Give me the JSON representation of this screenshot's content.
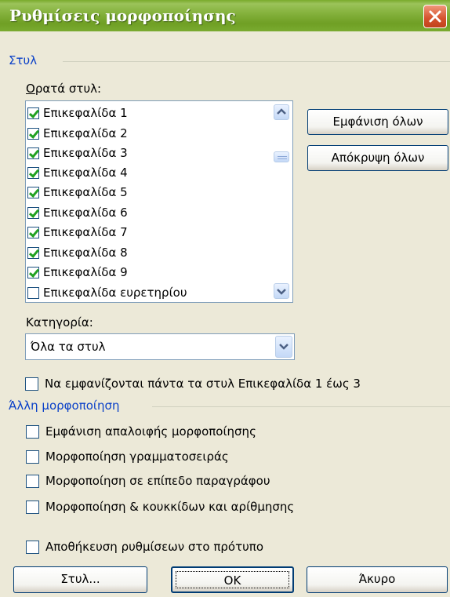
{
  "window": {
    "title": "Ρυθμίσεις μορφοποίησης"
  },
  "styles_group": {
    "label": "Στυλ",
    "visible_styles_label": "Ορατά στυλ:",
    "items": [
      {
        "label": "Επικεφαλίδα 1",
        "checked": true
      },
      {
        "label": "Επικεφαλίδα 2",
        "checked": true
      },
      {
        "label": "Επικεφαλίδα 3",
        "checked": true
      },
      {
        "label": "Επικεφαλίδα 4",
        "checked": true
      },
      {
        "label": "Επικεφαλίδα 5",
        "checked": true
      },
      {
        "label": "Επικεφαλίδα 6",
        "checked": true
      },
      {
        "label": "Επικεφαλίδα 7",
        "checked": true
      },
      {
        "label": "Επικεφαλίδα 8",
        "checked": true
      },
      {
        "label": "Επικεφαλίδα 9",
        "checked": true
      },
      {
        "label": "Επικεφαλίδα ευρετηρίου",
        "checked": false
      }
    ],
    "show_all_button": "Εμφάνιση όλων",
    "hide_all_button": "Απόκρυψη όλων",
    "category_label": "Κατηγορία:",
    "category_value": "Όλα τα στυλ",
    "always_show_headings": {
      "label": "Να εμφανίζονται πάντα τα στυλ Επικεφαλίδα 1 έως 3",
      "checked": false
    }
  },
  "other_formatting_group": {
    "label": "Άλλη μορφοποίηση",
    "options": [
      {
        "label": "Εμφάνιση απαλοιφής μορφοποίησης",
        "checked": false
      },
      {
        "label": "Μορφοποίηση γραμματοσειράς",
        "checked": false
      },
      {
        "label": "Μορφοποίηση σε επίπεδο παραγράφου",
        "checked": false
      },
      {
        "label": "Μορφοποίηση & κουκκίδων και αρίθμησης",
        "checked": false
      }
    ]
  },
  "save_in_template": {
    "label": "Αποθήκευση ρυθμίσεων στο πρότυπο",
    "checked": false
  },
  "buttons": {
    "styles": "Στυλ...",
    "ok": "OK",
    "cancel": "Άκυρο"
  },
  "icons": {
    "close": "close-icon",
    "scroll_up": "scroll-up-arrow-icon",
    "scroll_down": "scroll-down-arrow-icon",
    "dropdown": "chevron-down-icon"
  }
}
